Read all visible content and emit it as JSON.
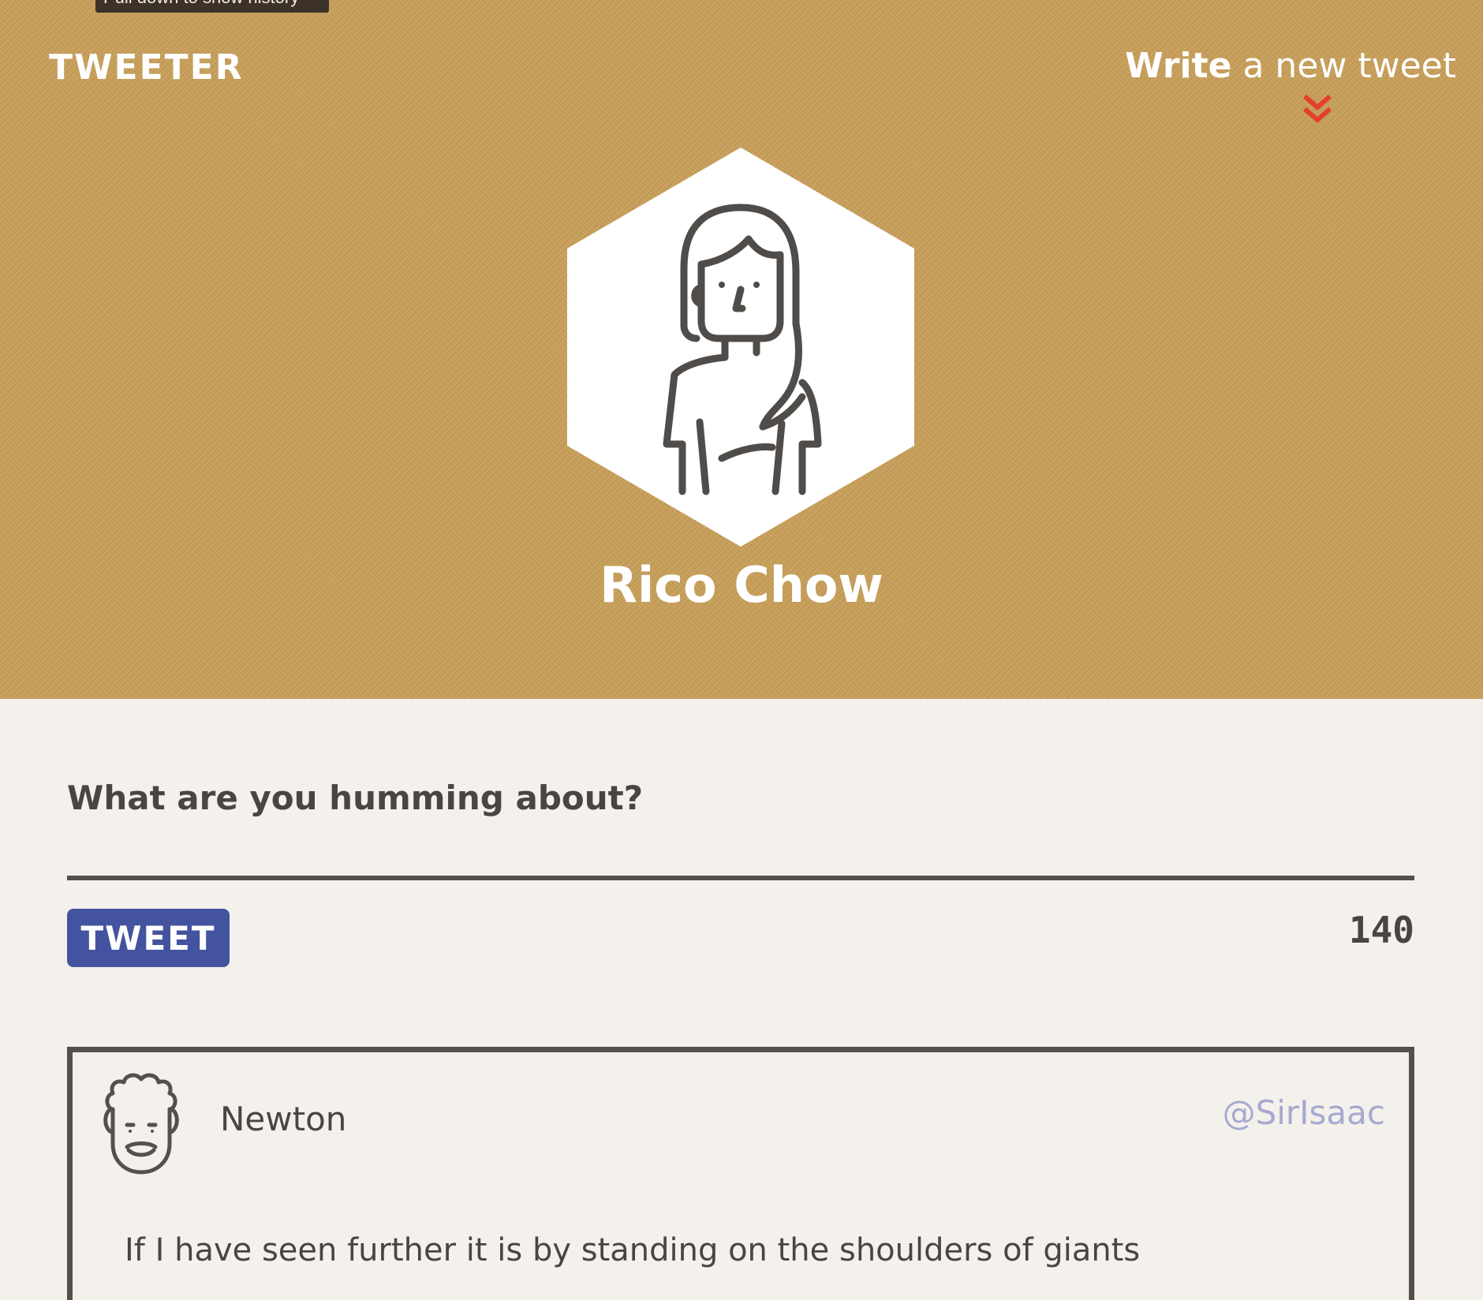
{
  "tooltip": {
    "text": "Pull down to show history"
  },
  "header": {
    "logo": "TWEETER",
    "write_link_strong": "Write",
    "write_link_rest": " a new tweet",
    "chevron_icon": "double-chevron-down-icon",
    "background_color": "#c9a05a"
  },
  "profile": {
    "name": "Rico Chow",
    "avatar_icon": "woman-long-hair-avatar-icon"
  },
  "composer": {
    "label": "What are you humming about?",
    "value": "",
    "button_label": "TWEET",
    "counter": "140",
    "button_color": "#4453a0"
  },
  "tweets": [
    {
      "author": "Newton",
      "handle": "@SirIsaac",
      "text": "If I have seen further it is by standing on the shoulders of giants",
      "avatar_icon": "curly-hair-man-avatar-icon"
    }
  ],
  "colors": {
    "accent_red": "#e53e2a",
    "text_dark": "#4a4541",
    "handle": "#a6a9cf",
    "page_bg": "#f4f1ec"
  }
}
